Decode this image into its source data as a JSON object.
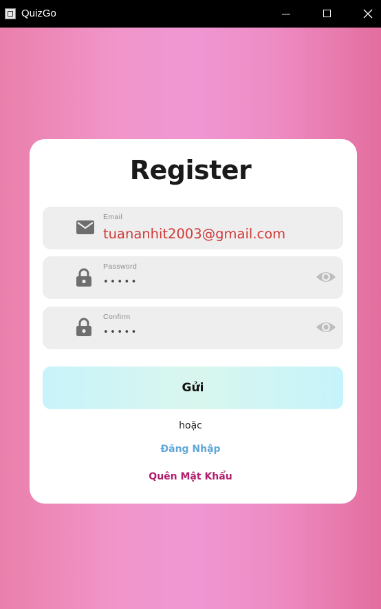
{
  "window": {
    "title": "QuizGo",
    "icons": {
      "app": "app-icon",
      "minimize": "minimize-icon",
      "maximize": "maximize-icon",
      "close": "close-icon"
    }
  },
  "form": {
    "heading": "Register",
    "email": {
      "label": "Email",
      "value": "tuananhit2003@gmail.com",
      "icon": "mail-icon"
    },
    "password": {
      "label": "Password",
      "value": "•••••",
      "icon": "lock-icon",
      "toggle_icon": "eye-icon"
    },
    "confirm": {
      "label": "Confirm",
      "value": "•••••",
      "icon": "lock-icon",
      "toggle_icon": "eye-icon"
    },
    "submit_label": "Gửi",
    "or_text": "hoặc",
    "login_link": "Đăng Nhập",
    "forgot_link": "Quên Mật Khẩu"
  },
  "colors": {
    "titlebar": "#000000",
    "card": "#ffffff",
    "field_bg": "#eeeeee",
    "email_text": "#d03a3a",
    "login_link": "#5fa8d9",
    "forgot_link": "#b01e6c",
    "submit_gradient_start": "#c8f3fb",
    "submit_gradient_mid": "#d9f6ee",
    "bg_pink": "#f097d3"
  }
}
